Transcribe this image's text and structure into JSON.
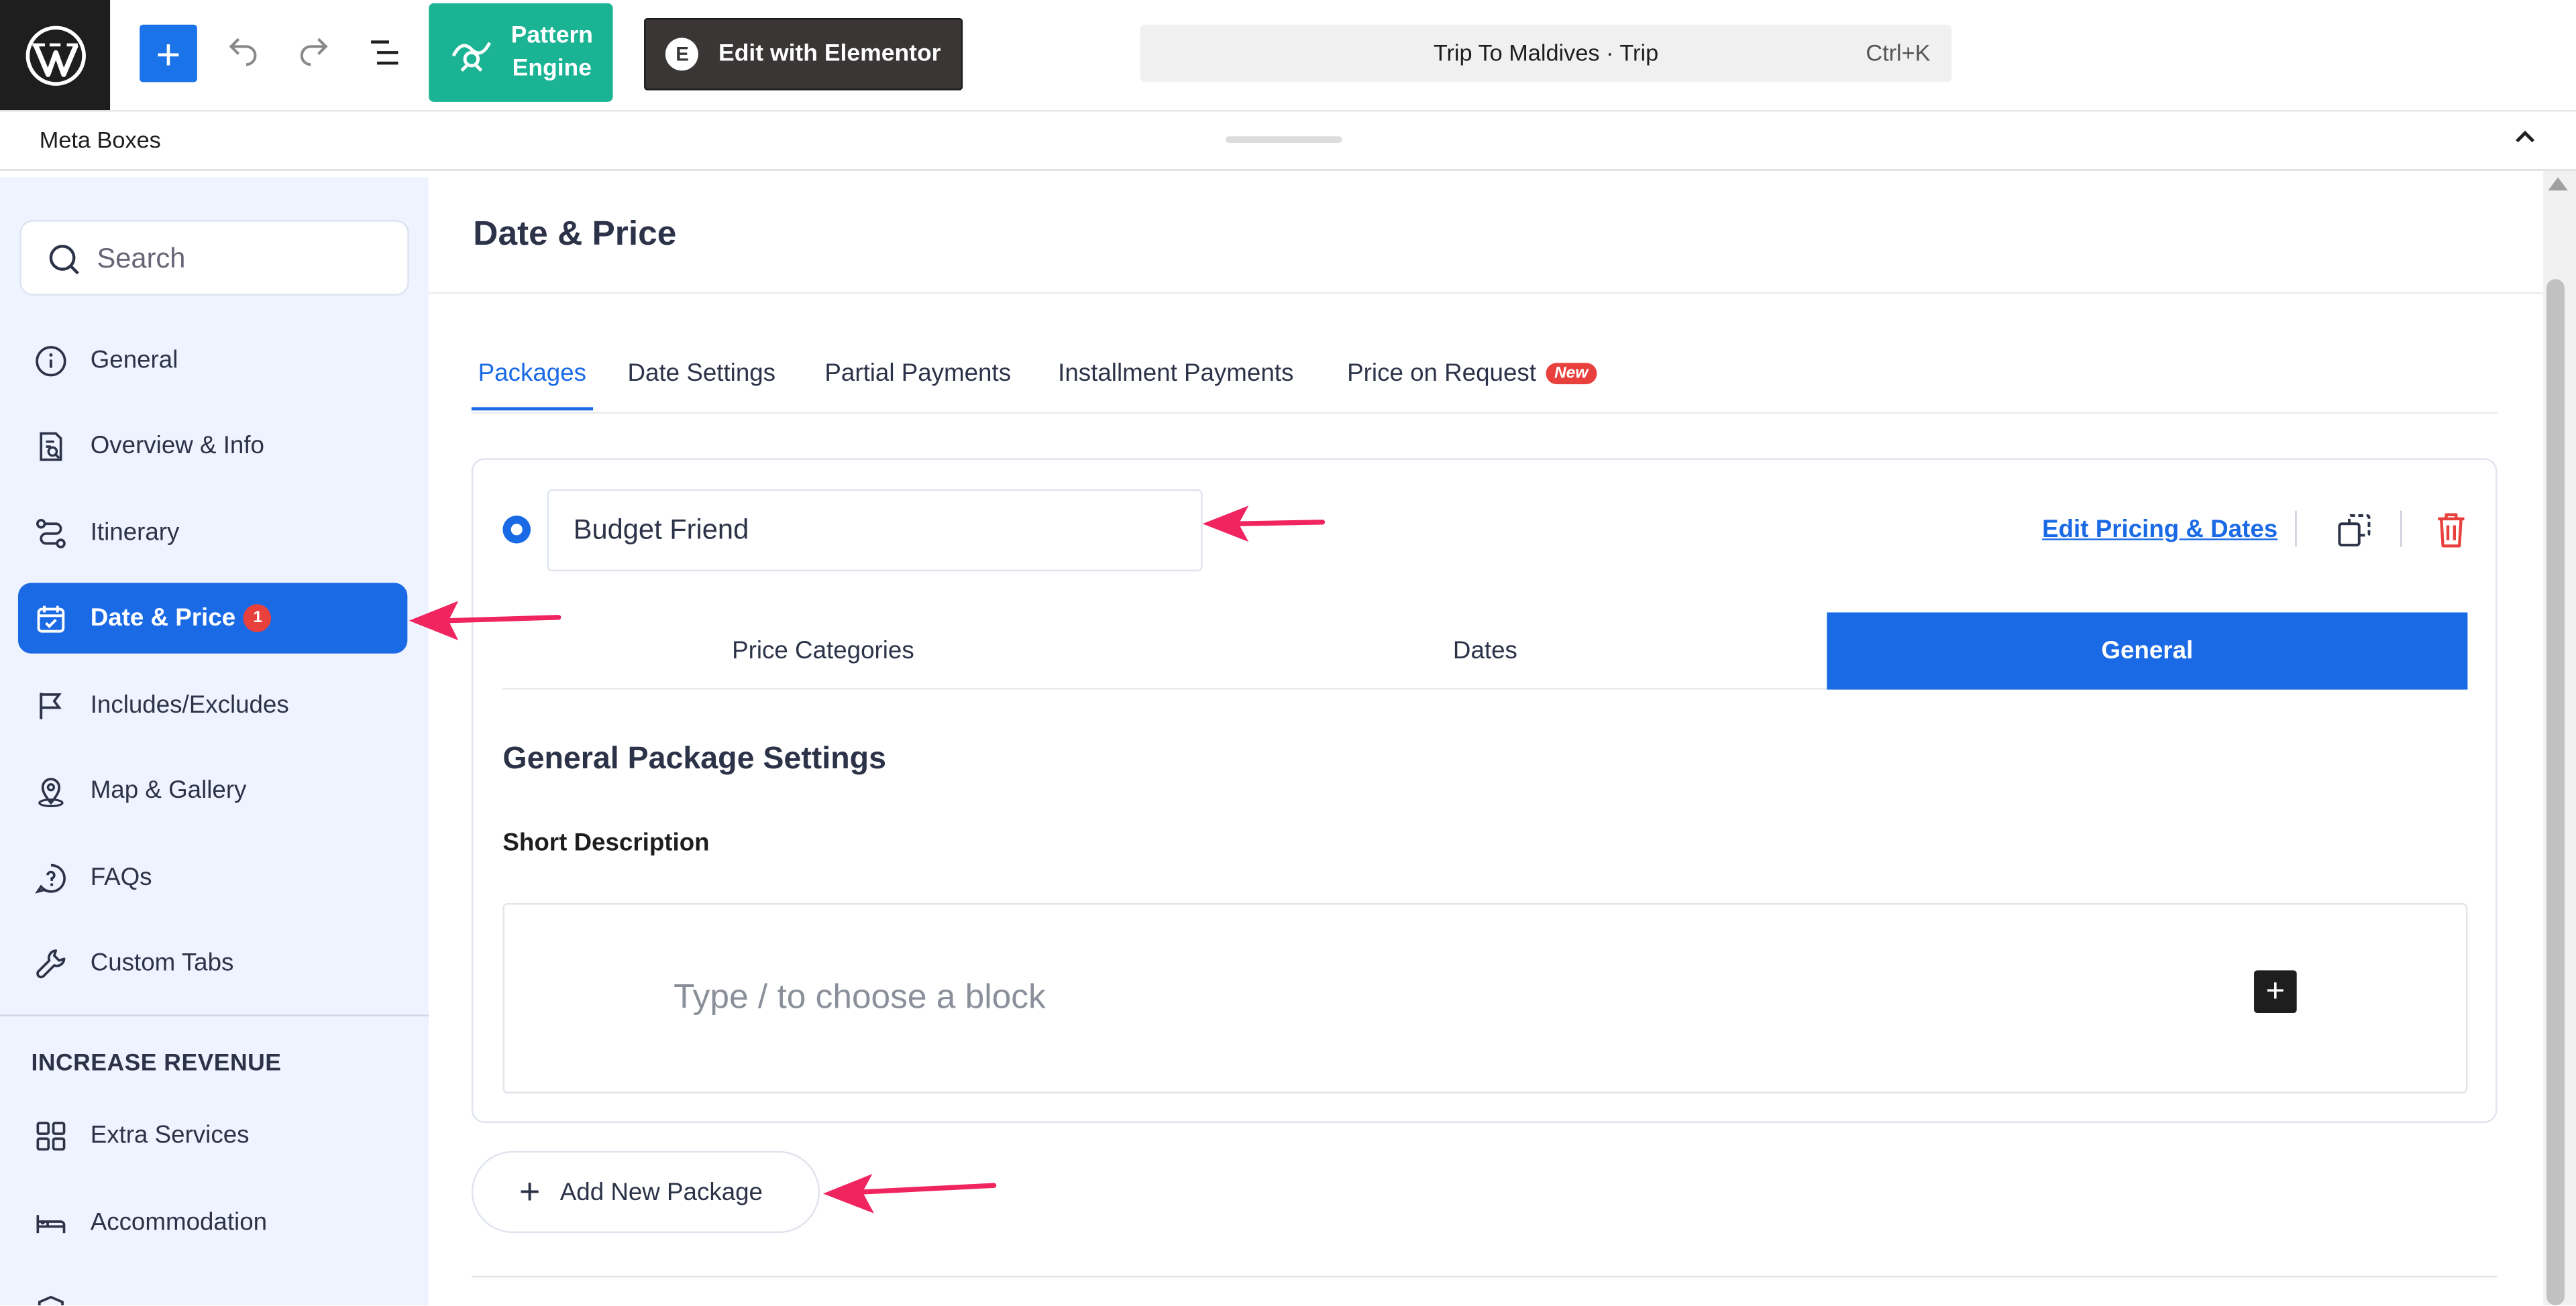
{
  "topbar": {
    "pattern_engine_label_1": "Pattern",
    "pattern_engine_label_2": "Engine",
    "elementor_label": "Edit with Elementor",
    "command_title": "Trip To Maldives · Trip",
    "command_shortcut": "Ctrl+K"
  },
  "metabar": {
    "label": "Meta Boxes"
  },
  "sidebar": {
    "search_placeholder": "Search",
    "items": [
      {
        "label": "General",
        "icon": "info-icon"
      },
      {
        "label": "Overview & Info",
        "icon": "document-search-icon"
      },
      {
        "label": "Itinerary",
        "icon": "route-icon"
      },
      {
        "label": "Date & Price",
        "icon": "calendar-check-icon",
        "badge": "1",
        "active": true
      },
      {
        "label": "Includes/Excludes",
        "icon": "flag-icon"
      },
      {
        "label": "Map & Gallery",
        "icon": "map-pin-icon"
      },
      {
        "label": "FAQs",
        "icon": "question-bubble-icon"
      },
      {
        "label": "Custom Tabs",
        "icon": "wrench-icon"
      }
    ],
    "section_title": "INCREASE REVENUE",
    "revenue_items": [
      {
        "label": "Extra Services",
        "icon": "grid-icon"
      },
      {
        "label": "Accommodation",
        "icon": "bed-icon"
      }
    ]
  },
  "main": {
    "title": "Date & Price",
    "tabs": [
      {
        "label": "Packages",
        "active": true
      },
      {
        "label": "Date Settings"
      },
      {
        "label": "Partial Payments"
      },
      {
        "label": "Installment Payments"
      },
      {
        "label": "Price on Request",
        "badge": "New"
      }
    ],
    "package": {
      "name_value": "Budget Friend",
      "edit_link": "Edit Pricing & Dates",
      "subtabs": [
        {
          "label": "Price Categories"
        },
        {
          "label": "Dates"
        },
        {
          "label": "General",
          "active": true
        }
      ],
      "section_heading": "General Package Settings",
      "short_description_label": "Short Description",
      "editor_placeholder": "Type / to choose a block"
    },
    "add_package_label": "Add New Package"
  },
  "colors": {
    "accent": "#1a6ae6",
    "pattern_engine": "#1ab394",
    "annotation_arrow": "#f0245f",
    "badge_red": "#e8413d"
  }
}
